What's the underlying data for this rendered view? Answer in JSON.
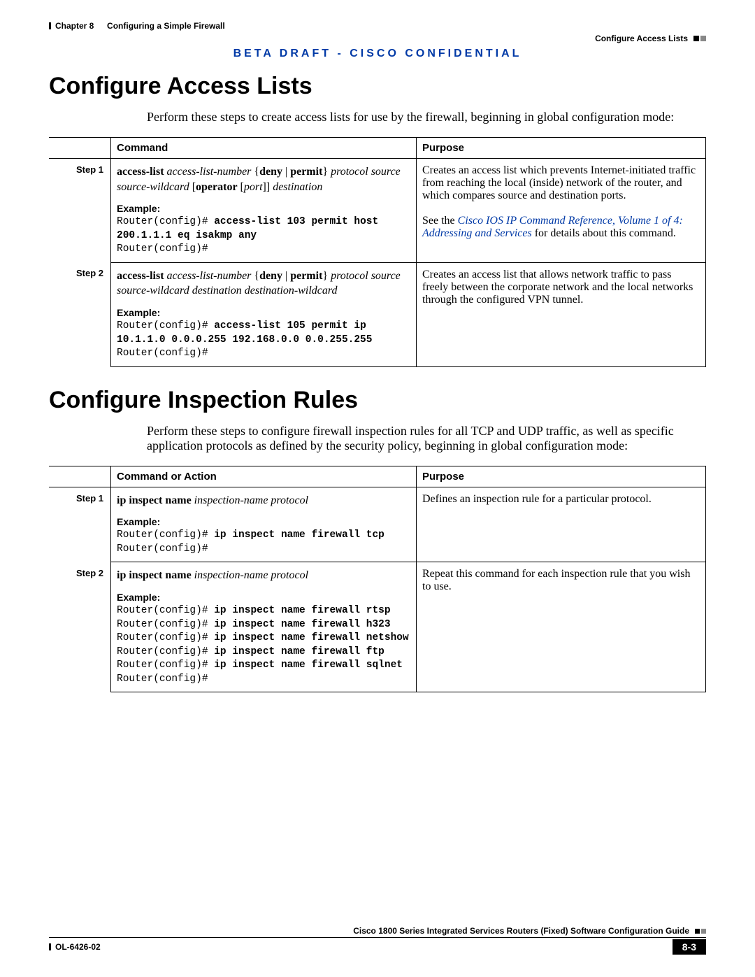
{
  "header": {
    "chapter": "Chapter 8",
    "chapter_title": "Configuring a Simple Firewall",
    "section_crumb": "Configure Access Lists"
  },
  "confidential": "BETA DRAFT - CISCO CONFIDENTIAL",
  "section1": {
    "title": "Configure Access Lists",
    "intro": "Perform these steps to create access lists for use by the firewall, beginning in global configuration mode:",
    "headers": {
      "command": "Command",
      "purpose": "Purpose"
    },
    "steps": [
      {
        "step": "Step 1",
        "syntax_html": "<span class='kw'>access-list</span> <span class='arg'>access-list-number</span> {<span class='kw'>deny</span> | <span class='kw'>permit</span>} <span class='arg'>protocol source source-wildcard</span> [<span class='kw'>operator</span> [<span class='arg'>port</span>]] <span class='arg'>destination</span>",
        "example_label": "Example:",
        "example_html": "Router(config)# <span class='b'>access-list 103 permit host 200.1.1.1 eq isakmp any</span>\nRouter(config)#",
        "purpose_html": "Creates an access list which prevents Internet-initiated traffic from reaching the local (inside) network of the router, and which compares source and destination ports.<br><br>See the <span class='link'>Cisco IOS IP Command Reference, Volume 1 of 4: Addressing and Services</span> for details about this command."
      },
      {
        "step": "Step 2",
        "syntax_html": "<span class='kw'>access-list</span> <span class='arg'>access-list-number</span> {<span class='kw'>deny</span> | <span class='kw'>permit</span>} <span class='arg'>protocol source source-wildcard destination destination-wildcard</span>",
        "example_label": "Example:",
        "example_html": "Router(config)# <span class='b'>access-list 105 permit ip 10.1.1.0 0.0.0.255 192.168.0.0 0.0.255.255</span>\nRouter(config)#",
        "purpose_html": "Creates an access list that allows network traffic to pass freely between the corporate network and the local networks through the configured VPN tunnel."
      }
    ]
  },
  "section2": {
    "title": "Configure Inspection Rules",
    "intro": "Perform these steps to configure firewall inspection rules for all TCP and UDP traffic, as well as specific application protocols as defined by the security policy, beginning in global configuration mode:",
    "headers": {
      "command": "Command or Action",
      "purpose": "Purpose"
    },
    "steps": [
      {
        "step": "Step 1",
        "syntax_html": "<span class='kw'>ip inspect name</span> <span class='arg'>inspection-name protocol</span>",
        "example_label": "Example:",
        "example_html": "Router(config)# <span class='b'>ip inspect name firewall tcp</span>\nRouter(config)#",
        "purpose_html": "Defines an inspection rule for a particular protocol."
      },
      {
        "step": "Step 2",
        "syntax_html": "<span class='kw'>ip inspect name</span> <span class='arg'>inspection-name protocol</span>",
        "example_label": "Example:",
        "example_html": "Router(config)# <span class='b'>ip inspect name firewall rtsp</span>\nRouter(config)# <span class='b'>ip inspect name firewall h323</span>\nRouter(config)# <span class='b'>ip inspect name firewall netshow</span>\nRouter(config)# <span class='b'>ip inspect name firewall ftp</span>\nRouter(config)# <span class='b'>ip inspect name firewall sqlnet</span>\nRouter(config)#",
        "purpose_html": "Repeat this command for each inspection rule that you wish to use."
      }
    ]
  },
  "footer": {
    "guide": "Cisco 1800 Series Integrated Services Routers (Fixed) Software Configuration Guide",
    "doc_id": "OL-6426-02",
    "page": "8-3"
  }
}
